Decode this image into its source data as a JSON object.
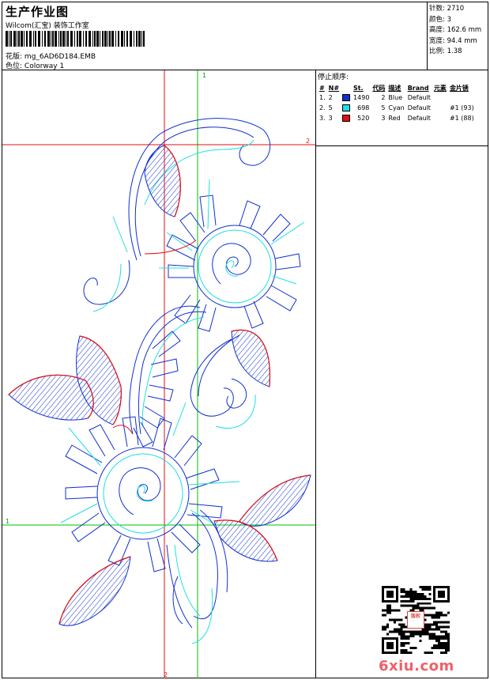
{
  "header": {
    "title": "生产作业图",
    "studio": "Wilcom(汇宝) 装饰工作室",
    "design_label": "花版:",
    "design_name": "mg_6AD6D184.EMB",
    "colorway_label": "色位:",
    "colorway_name": "Colorway 1"
  },
  "stats": [
    {
      "label": "针数:",
      "value": "2710"
    },
    {
      "label": "颜色:",
      "value": "3"
    },
    {
      "label": "高度:",
      "value": "162.6 mm"
    },
    {
      "label": "宽度:",
      "value": "94.4 mm"
    },
    {
      "label": "比例:",
      "value": "1.38"
    }
  ],
  "stop_sequence": {
    "title": "停止顺序:",
    "columns": [
      "#",
      "N#",
      "",
      "St.",
      "代码",
      "描述",
      "Brand",
      "元素",
      "金片锈"
    ],
    "rows": [
      {
        "index": "1.",
        "needle": "2",
        "color": "#1030d0",
        "stitches": "1490",
        "code": "2",
        "description": "Blue",
        "brand": "Default",
        "element": "",
        "sequin": ""
      },
      {
        "index": "2.",
        "needle": "5",
        "color": "#20e0e0",
        "stitches": "698",
        "code": "5",
        "description": "Cyan",
        "brand": "Default",
        "element": "",
        "sequin": "#1 (93)"
      },
      {
        "index": "3.",
        "needle": "3",
        "color": "#e01010",
        "stitches": "520",
        "code": "3",
        "description": "Red",
        "brand": "Default",
        "element": "",
        "sequin": "#1 (88)"
      }
    ]
  },
  "guides": {
    "vertical_1": "1",
    "horizontal_2": "2",
    "horizontal_1": "1",
    "vertical_2": "2"
  },
  "colors": {
    "blue": "#1030d0",
    "cyan": "#20e0e0",
    "red": "#e01010",
    "guide_green": "#00c000",
    "guide_red": "#e01010"
  },
  "seal_text": "版权",
  "watermark": "6xiu.com"
}
